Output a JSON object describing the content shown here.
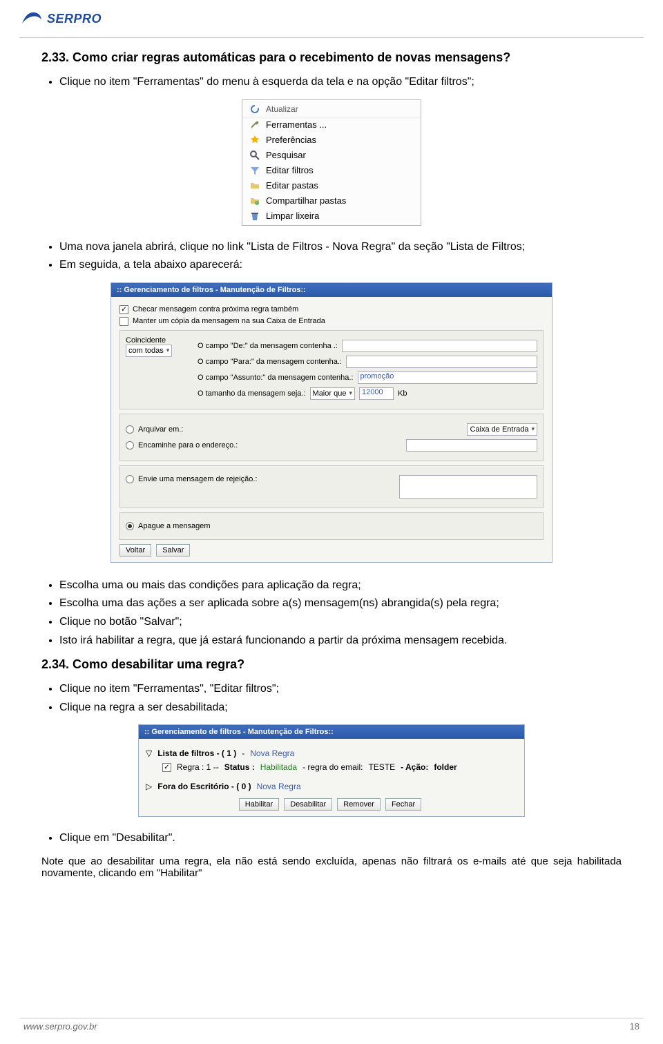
{
  "brand": {
    "name": "SERPRO"
  },
  "section233": {
    "title": "2.33. Como criar regras automáticas para o recebimento de novas mensagens?",
    "step1": "Clique no item \"Ferramentas\" do menu à esquerda da tela e na opção \"Editar filtros\";",
    "step2a": "Uma nova janela abrirá, clique no link \"Lista de Filtros - Nova Regra\" da seção \"Lista de Filtros;",
    "step2b": "Em seguida, a tela abaixo aparecerá:",
    "step3a": "Escolha uma ou mais das condições para aplicação da regra;",
    "step3b": "Escolha uma das ações a ser aplicada sobre a(s) mensagem(ns) abrangida(s) pela regra;",
    "step3c": "Clique no botão \"Salvar\";",
    "step3d": "Isto irá habilitar a regra, que já estará funcionando a partir da próxima mensagem recebida."
  },
  "section234": {
    "title": "2.34. Como desabilitar uma regra?",
    "step1": "Clique no item \"Ferramentas\", \"Editar filtros\";",
    "step2": "Clique na regra a ser desabilitada;",
    "step3": "Clique em \"Desabilitar\".",
    "note": "Note que ao desabilitar uma regra, ela não está sendo excluída, apenas não filtrará os e-mails até que seja habilitada novamente, clicando em \"Habilitar\""
  },
  "tools_menu": {
    "top": "Atualizar",
    "items": [
      "Ferramentas ...",
      "Preferências",
      "Pesquisar",
      "Editar filtros",
      "Editar pastas",
      "Compartilhar pastas",
      "Limpar lixeira"
    ]
  },
  "filter_editor": {
    "title": ":: Gerenciamento de filtros - Manutenção de Filtros::",
    "chk1": "Checar mensagem contra próxima regra também",
    "chk2": "Manter um cópia da mensagem na sua Caixa de Entrada",
    "match_label": "Coincidente",
    "match_value": "com todas",
    "cond_de": "O campo \"De:\" da mensagem contenha .:",
    "cond_para": "O campo \"Para:\" da mensagem contenha.:",
    "cond_assunto": "O campo \"Assunto:\" da mensagem contenha.:",
    "assunto_val": "promoção",
    "cond_tamanho": "O tamanho da mensagem seja.:",
    "tam_op": "Maior que",
    "tam_val": "12000",
    "tam_unit": "Kb",
    "act_arquivar": "Arquivar em.:",
    "arquivar_val": "Caixa de Entrada",
    "act_encaminhar": "Encaminhe para o endereço.:",
    "act_rejeicao": "Envie uma mensagem de rejeição.:",
    "act_apague": "Apague a mensagem",
    "btn_voltar": "Voltar",
    "btn_salvar": "Salvar"
  },
  "filter_list": {
    "title": ":: Gerenciamento de filtros - Manutenção de Filtros::",
    "row1_prefix": "Lista de filtros - ( 1 )",
    "row1_link": "Nova Regra",
    "rule_prefix": "Regra : 1 --",
    "rule_status_label": "Status :",
    "rule_status_value": "Habilitada",
    "rule_desc": "- regra do email:",
    "rule_name": "TESTE",
    "rule_action_label": "- Ação:",
    "rule_action_value": "folder",
    "row3_prefix": "Fora do Escritório - ( 0 )",
    "row3_link": "Nova Regra",
    "btn_habilitar": "Habilitar",
    "btn_desabilitar": "Desabilitar",
    "btn_remover": "Remover",
    "btn_fechar": "Fechar"
  },
  "footer": {
    "site": "www.serpro.gov.br",
    "page": "18"
  }
}
